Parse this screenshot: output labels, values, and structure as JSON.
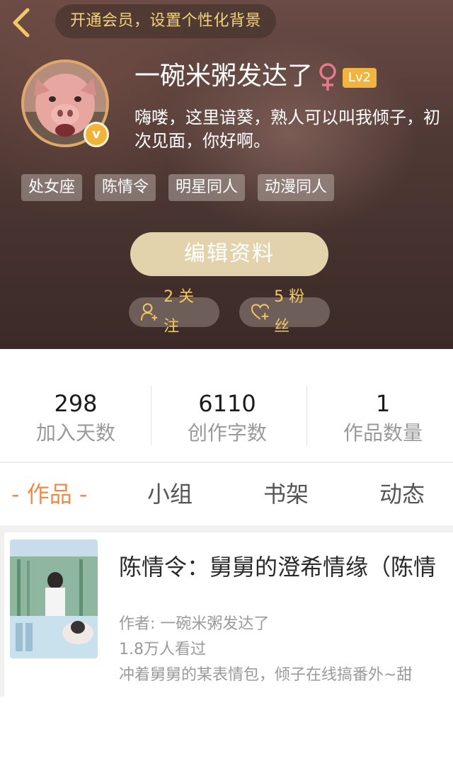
{
  "header": {
    "vip_banner": "开通会员，设置个性化背景",
    "avatar_badge": "v",
    "username": "一碗米粥发达了",
    "gender_symbol": "♀",
    "level": "Lv2",
    "bio": "嗨喽，这里谙葵，熟人可以叫我倾子，初次见面，你好啊。",
    "tags": [
      "处女座",
      "陈情令",
      "明星同人",
      "动漫同人"
    ],
    "edit_button": "编辑资料",
    "follow_label": "2 关注",
    "fans_label": "5 粉丝",
    "colors": {
      "accent_gold": "#f2c866",
      "level_badge": "#f2b440",
      "gender_pink": "#e77a8a"
    }
  },
  "stats": [
    {
      "value": "298",
      "label": "加入天数"
    },
    {
      "value": "6110",
      "label": "创作字数"
    },
    {
      "value": "1",
      "label": "作品数量"
    }
  ],
  "tabs": {
    "works": "- 作品 -",
    "groups": "小组",
    "shelf": "书架",
    "moments": "动态",
    "active_color": "#f08a4a"
  },
  "work": {
    "title": "陈情令：舅舅的澄希情缘（陈情",
    "author": "作者: 一碗米粥发达了",
    "views": "1.8万人看过",
    "description": "冲着舅舅的某表情包，倾子在线搞番外~甜"
  },
  "icons": [
    "back-arrow-icon",
    "female-icon",
    "person-add-icon",
    "heart-add-icon"
  ]
}
